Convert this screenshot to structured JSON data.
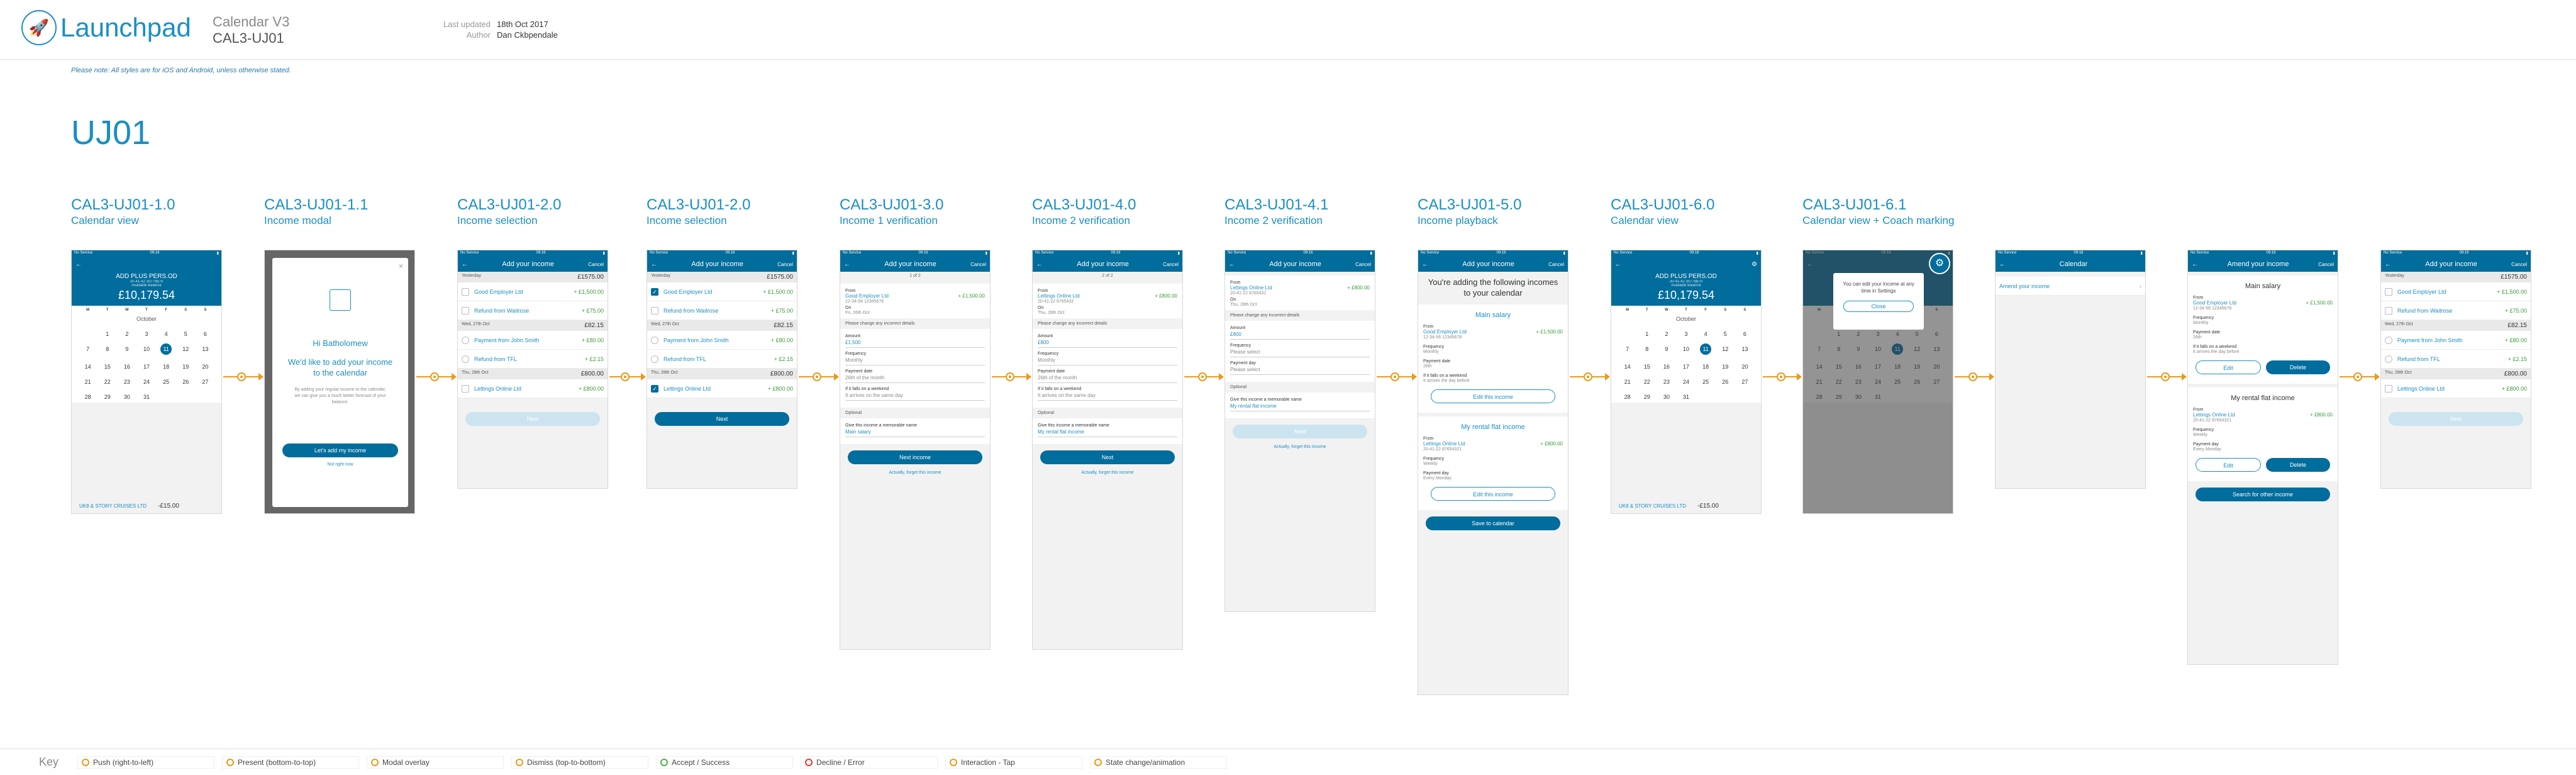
{
  "header": {
    "logo_text": "Launchpad",
    "project": "Calendar V3",
    "doc_id": "CAL3-UJ01",
    "last_updated_label": "Last updated",
    "last_updated_value": "18th Oct 2017",
    "author_label": "Author",
    "author_value": "Dan Ckbpendale"
  },
  "note": "Please note: All styles are for iOS and Android, unless otherwise stated.",
  "page_title": "UJ01",
  "screens": [
    {
      "id": "CAL3-UJ01-1.0",
      "sub": "Calendar view"
    },
    {
      "id": "CAL3-UJ01-1.1",
      "sub": "Income modal"
    },
    {
      "id": "CAL3-UJ01-2.0",
      "sub": "Income selection"
    },
    {
      "id": "CAL3-UJ01-2.0",
      "sub": "Income selection"
    },
    {
      "id": "CAL3-UJ01-3.0",
      "sub": "Income 1 verification"
    },
    {
      "id": "CAL3-UJ01-4.0",
      "sub": "Income 2 verification"
    },
    {
      "id": "CAL3-UJ01-4.1",
      "sub": "Income 2 verification"
    },
    {
      "id": "CAL3-UJ01-5.0",
      "sub": "Income playback"
    },
    {
      "id": "CAL3-UJ01-6.0",
      "sub": "Calendar view"
    },
    {
      "id": "CAL3-UJ01-6.1",
      "sub": "Calendar view + Coach marking"
    }
  ],
  "phone": {
    "status": "No Service",
    "time": "09:16",
    "cancel": "Cancel",
    "add_income": "Add your income",
    "account": "ADD PLUS PERS.OD",
    "sort_code": "20-41-42 30779870",
    "available": "Available Balance",
    "balance": "£10,179.54",
    "weekdays": [
      "M",
      "T",
      "W",
      "T",
      "F",
      "S",
      "S"
    ],
    "month": "October",
    "days": [
      "",
      "1",
      "2",
      "3",
      "4",
      "5",
      "6",
      "7",
      "8",
      "9",
      "10",
      "11",
      "12",
      "13",
      "14",
      "15",
      "16",
      "17",
      "18",
      "19",
      "20",
      "21",
      "22",
      "23",
      "24",
      "25",
      "26",
      "27",
      "28",
      "29",
      "30",
      "31",
      "",
      ""
    ],
    "selected_day": "11",
    "cal_foot_name": "UK8 & STORY CRUISES LTD",
    "cal_foot_amt": "-£15.00"
  },
  "modal": {
    "greeting": "Hi Batholomew",
    "title": "We'd like to add your income to the calendar",
    "body": "By adding your regular income to the calendar, we can give you a much better forecast of your balance.",
    "cta": "Let's add my income",
    "link": "Not right now"
  },
  "income_list": {
    "groups": [
      {
        "date": "Yesterday",
        "bal": "£1575.00",
        "items": [
          {
            "n": "Good Employer Ltd",
            "v": "+ £1,500.00"
          },
          {
            "n": "Refund from Waitrose",
            "v": "+ £75.00"
          }
        ]
      },
      {
        "date": "Wed, 27th Oct",
        "bal": "£82.15",
        "items": [
          {
            "n": "Payment from John Smith",
            "v": "+ £80.00"
          },
          {
            "n": "Refund from TFL",
            "v": "+ £2.15"
          }
        ]
      },
      {
        "date": "Thu, 28th Oct",
        "bal": "£800.00",
        "items": [
          {
            "n": "Lettings Online Ltd",
            "v": "+ £800.00"
          }
        ]
      }
    ],
    "next": "Next"
  },
  "verify1": {
    "step": "1 of 2",
    "from": "From",
    "name": "Good Employer Ltd",
    "amt": "+ £1,500.00",
    "ref": "12-34-56   12345678",
    "on": "On",
    "date": "Fri, 26th Oct",
    "change": "Please change any incorrect details",
    "amount_l": "Amount",
    "amount_v": "£1,500",
    "freq_l": "Frequency",
    "freq_v": "Monthly",
    "pd_l": "Payment date",
    "pd_v": "26th of the month",
    "wk_l": "If it falls on a weekend",
    "wk_v": "It arrives on the same day",
    "opt": "Optional",
    "memo_l": "Give this income a memorable name",
    "memo_v": "Main salary",
    "btn": "Next income",
    "link": "Actually, forget this income"
  },
  "verify2": {
    "step": "2 of 2",
    "name": "Lettings Online Ltd",
    "amt": "+ £800.00",
    "ref": "20-41-22   8765432",
    "date": "Thu, 28th Oct",
    "amount_v": "£800",
    "freq_v": "Monthly",
    "pd_v": "26th of the month",
    "wk_v": "It arrives on the same day",
    "memo_v": "My rental flat income",
    "btn": "Next",
    "link": "Actually, forget this income"
  },
  "verify21": {
    "name": "Lettings Online Ltd",
    "amt": "+ £800.00",
    "ref": "20-41-22  8765432",
    "date": "Thu, 28th Oct",
    "amount_v": "£800",
    "freq_v": "Please select",
    "pday_l": "Payment day",
    "pday_v": "Please select",
    "opt": "Optional",
    "memo_l": "Give this income a memorable name",
    "memo_v": "My rental flat income",
    "btn": "Next",
    "link": "Actually, forget this income"
  },
  "playback": {
    "title": "You're adding the following incomes to your calendar",
    "c1": "Main salary",
    "c1_name": "Good Employer Ltd",
    "c1_amt": "+ £1,500.00",
    "c1_ref": "12-34-56   12345678",
    "freq_l": "Frequency",
    "c1_freq": "Monthly",
    "pd_l": "Payment date",
    "c1_pd": "26th",
    "wk_l": "If it falls on a weekend",
    "c1_wk": "It arrives the day before",
    "edit": "Edit this income",
    "c2": "My rental flat income",
    "c2_name": "Lettings Online Ltd",
    "c2_amt": "+ £800.00",
    "c2_ref": "20-41-22   87654321",
    "c2_freq": "Weekly",
    "pday_l": "Payment day",
    "c2_pd": "Every Monday",
    "save": "Save to calendar"
  },
  "coach": {
    "text": "You can edit your income at any time in Settings",
    "btn": "Close"
  },
  "settings": {
    "title": "Calendar",
    "item": "Amend your income"
  },
  "amend": {
    "title": "Amend your income",
    "c1": "Main salary",
    "c1_name": "Good Employer Ltd",
    "c1_amt": "+ £1,500.00",
    "c1_ref": "12-34-56   12345678",
    "freq_l": "Frequency",
    "c1_freq": "Monthly",
    "pd_l": "Payment date",
    "c1_pd": "26th",
    "wk_l": "If it falls on a weekend",
    "c1_wk": "It arrives the day before",
    "edit": "Edit",
    "del": "Delete",
    "c2": "My rental flat income",
    "c2_name": "Lettings Online Ltd",
    "c2_amt": "+ £800.00",
    "c2_ref": "20-41-22   87654321",
    "c2_freq": "Weekly",
    "pday_l": "Payment day",
    "c2_pd": "Every Monday",
    "search": "Search for other income"
  },
  "key": {
    "label": "Key",
    "items": [
      {
        "t": "Push (right-to-left)",
        "c": "#e89a1c"
      },
      {
        "t": "Present (bottom-to-top)",
        "c": "#e89a1c"
      },
      {
        "t": "Modal overlay",
        "c": "#e89a1c"
      },
      {
        "t": "Dismiss (top-to-bottom)",
        "c": "#e89a1c"
      },
      {
        "t": "Accept / Success",
        "c": "#4caf50"
      },
      {
        "t": "Decline / Error",
        "c": "#e53935"
      },
      {
        "t": "Interaction - Tap",
        "c": "#e89a1c"
      },
      {
        "t": "State change/animation",
        "c": "#e89a1c"
      }
    ]
  },
  "colors": {
    "brand": "#006d9c",
    "accent": "#1a8fc4",
    "success": "#3a9a3a",
    "flow": "#e89a1c"
  }
}
